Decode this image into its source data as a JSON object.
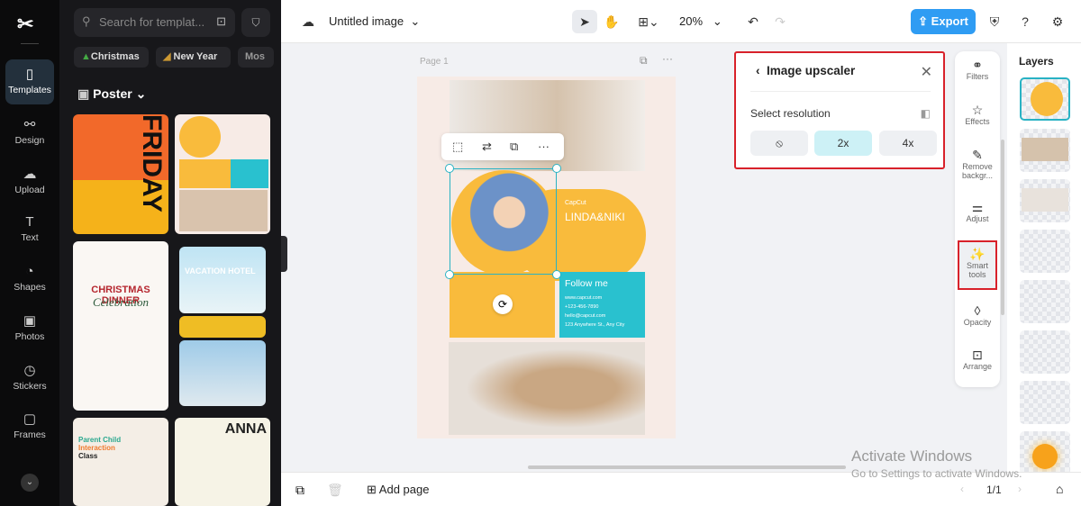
{
  "rail": {
    "items": [
      {
        "label": "Templates",
        "icon": "templates-icon"
      },
      {
        "label": "Design",
        "icon": "design-icon"
      },
      {
        "label": "Upload",
        "icon": "upload-icon"
      },
      {
        "label": "Text",
        "icon": "text-icon"
      },
      {
        "label": "Shapes",
        "icon": "shapes-icon"
      },
      {
        "label": "Photos",
        "icon": "photos-icon"
      },
      {
        "label": "Stickers",
        "icon": "stickers-icon"
      },
      {
        "label": "Frames",
        "icon": "frames-icon"
      }
    ]
  },
  "panel": {
    "search_placeholder": "Search for templat...",
    "chips": [
      "Christmas",
      "New Year",
      "Mos"
    ],
    "category": "Poster"
  },
  "topbar": {
    "title": "Untitled image",
    "zoom": "20%",
    "export": "Export"
  },
  "canvas": {
    "page_label": "Page 1",
    "card": {
      "brand": "CapCut",
      "name": "LINDA&NIKI",
      "follow": "Follow me",
      "contacts": [
        "www.capcut.com",
        "+123-456-7890",
        "hello@capcut.com",
        "123 Anywhere St., Any City"
      ]
    }
  },
  "popup": {
    "title": "Image upscaler",
    "label": "Select resolution",
    "options": [
      "⦸",
      "2x",
      "4x"
    ],
    "selected": "2x"
  },
  "tools": [
    {
      "label": "Filters"
    },
    {
      "label": "Effects"
    },
    {
      "label": "Remove backgr..."
    },
    {
      "label": "Adjust"
    },
    {
      "label": "Smart tools"
    },
    {
      "label": "Opacity"
    },
    {
      "label": "Arrange"
    }
  ],
  "layers": {
    "title": "Layers"
  },
  "bottom": {
    "add_page": "Add page",
    "page_count": "1/1"
  },
  "watermark": {
    "line1": "Activate Windows",
    "line2": "Go to Settings to activate Windows."
  },
  "colors": {
    "accent": "#2f9cf3",
    "highlight": "#d8212a",
    "teal": "#29b2c4",
    "yellow": "#f9bb3c"
  }
}
